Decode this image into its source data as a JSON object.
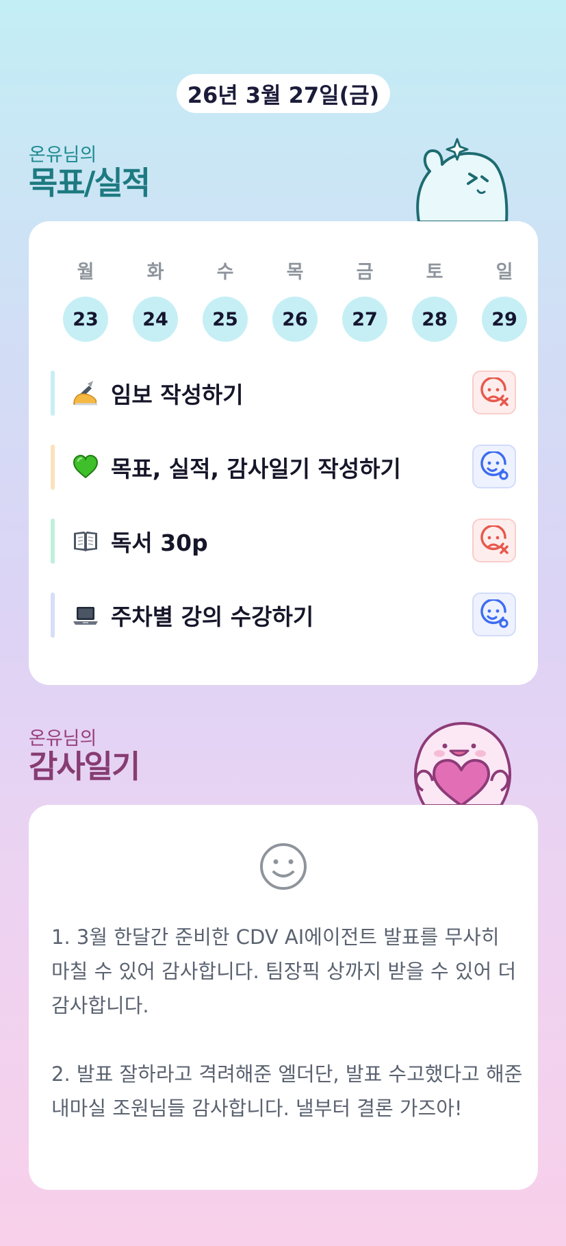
{
  "date": "26년 3월 27일(금)",
  "goals_section": {
    "subtitle": "온유님의",
    "title": "목표/실적"
  },
  "week": {
    "days": [
      {
        "name": "월",
        "num": "23"
      },
      {
        "name": "화",
        "num": "24"
      },
      {
        "name": "수",
        "num": "25"
      },
      {
        "name": "목",
        "num": "26"
      },
      {
        "name": "금",
        "num": "27"
      },
      {
        "name": "토",
        "num": "28"
      },
      {
        "name": "일",
        "num": "29"
      }
    ]
  },
  "goals": [
    {
      "emoji": "writing-hand-icon",
      "text": "임보 작성하기",
      "status": "not-done",
      "bar_color": "#c8eef5"
    },
    {
      "emoji": "green-heart-icon",
      "text": "목표, 실적, 감사일기 작성하기",
      "status": "done",
      "bar_color": "#fbe2bd"
    },
    {
      "emoji": "open-book-icon",
      "text": "독서 30p",
      "status": "not-done",
      "bar_color": "#bff0dc"
    },
    {
      "emoji": "laptop-icon",
      "text": "주차별 강의 수강하기",
      "status": "done",
      "bar_color": "#d6def8"
    }
  ],
  "thanks_section": {
    "subtitle": "온유님의",
    "title": "감사일기"
  },
  "thanks": {
    "icon": "smiley-icon",
    "text": "1. 3월 한달간 준비한 CDV AI에이전트 발표를 무사히 마칠 수 있어 감사합니다. 팀장픽 상까지 받을 수 있어 더 감사합니다.\n\n2. 발표 잘하라고 격려해준 엘더단, 발표 수고했다고 해준 내마실 조원님들 감사합니다. 낼부터 결론 가즈아!"
  },
  "colors": {
    "accent_teal": "#1d7a80",
    "accent_plum": "#873c72",
    "fail": "#e8584c",
    "ok": "#3d6cf0"
  }
}
